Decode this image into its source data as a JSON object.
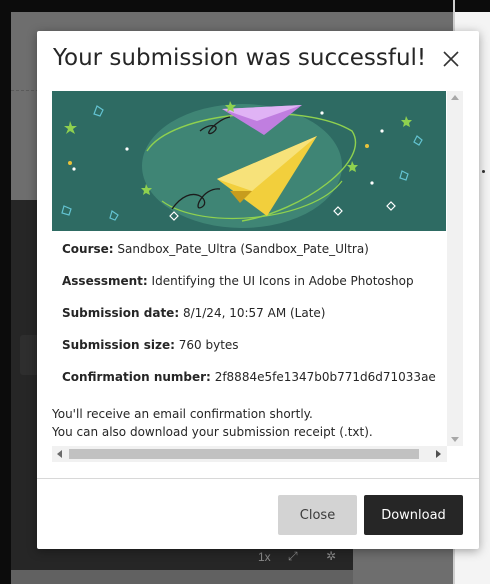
{
  "modal": {
    "title": "Your submission was successful!",
    "close_icon": "close-icon",
    "rows": [
      {
        "label": "Course:",
        "value": "Sandbox_Pate_Ultra (Sandbox_Pate_Ultra)"
      },
      {
        "label": "Assessment:",
        "value": "Identifying the UI Icons in Adobe Photoshop"
      },
      {
        "label": "Submission date:",
        "value": "8/1/24, 10:57 AM (Late)"
      },
      {
        "label": "Submission size:",
        "value": "760 bytes"
      },
      {
        "label": "Confirmation number:",
        "value": "2f8884e5fe1347b0b771d6d71033ae"
      }
    ],
    "notice_line1": "You'll receive an email confirmation shortly.",
    "notice_line2": "You can also download your submission receipt (.txt).",
    "close_button": "Close",
    "download_button": "Download"
  },
  "background": {
    "player_controls": "1x"
  },
  "colors": {
    "banner_bg": "#2e6b63",
    "accent_yellow": "#f2cf3c",
    "accent_purple": "#c07ee0",
    "button_dark": "#262626",
    "button_light": "#d3d3d3"
  }
}
